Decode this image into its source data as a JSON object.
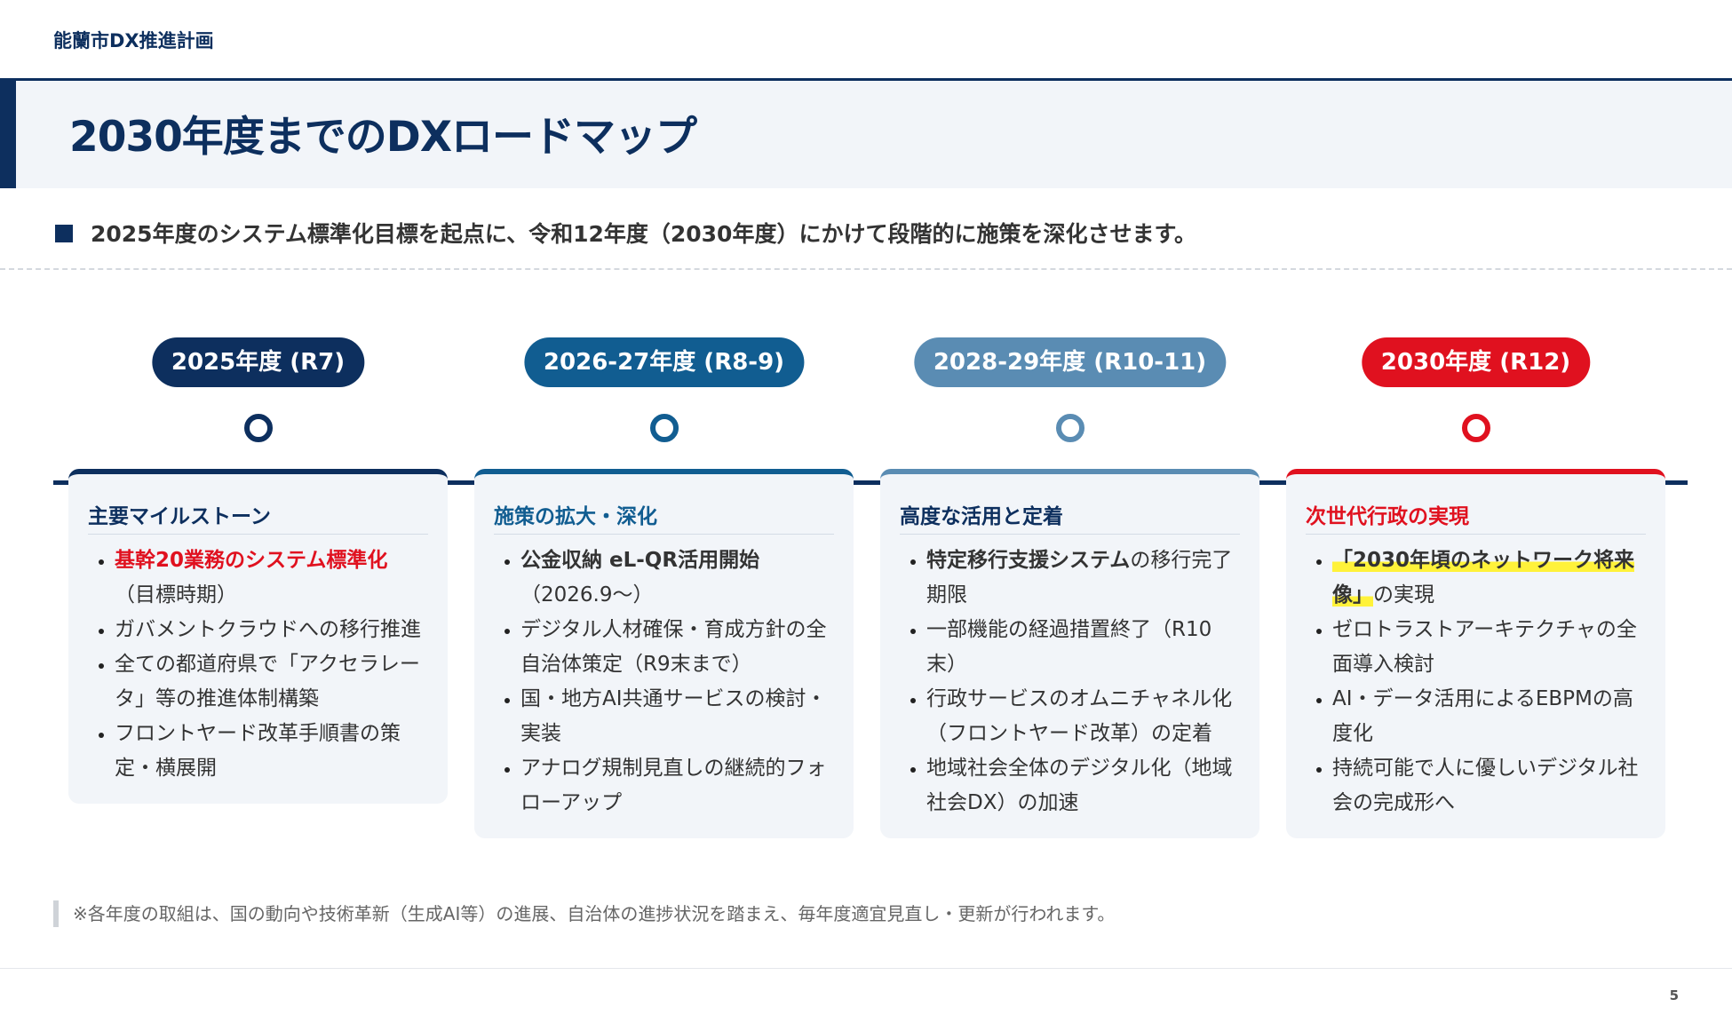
{
  "header": {
    "doc_label": "能蘭市DX推進計画",
    "title": "2030年度までのDXロードマップ"
  },
  "lead": "2025年度のシステム標準化目標を起点に、令和12年度（2030年度）にかけて段階的に施策を深化させます。",
  "colors": {
    "navy": "#0d2f5e",
    "blue": "#115d91",
    "steel": "#5a8cb3",
    "red": "#e0111f"
  },
  "phases": [
    {
      "label": "2025年度 (R7)",
      "heading": "主要マイルストーン",
      "items": [
        {
          "main": "基幹20業務のシステム標準化",
          "rest": "（目標時期）"
        },
        {
          "main": "",
          "rest": "ガバメントクラウドへの移行推進"
        },
        {
          "main": "",
          "rest": "全ての都道府県で「アクセラレータ」等の推進体制構築"
        },
        {
          "main": "",
          "rest": "フロントヤード改革手順書の策定・横展開"
        }
      ]
    },
    {
      "label": "2026-27年度 (R8-9)",
      "heading": "施策の拡大・深化",
      "items": [
        {
          "main": "公金収納 eL-QR活用開始",
          "rest": "（2026.9〜）"
        },
        {
          "main": "",
          "rest": "デジタル人材確保・育成方針の全自治体策定（R9末まで）"
        },
        {
          "main": "",
          "rest": "国・地方AI共通サービスの検討・実装"
        },
        {
          "main": "",
          "rest": "アナログ規制見直しの継続的フォローアップ"
        }
      ]
    },
    {
      "label": "2028-29年度 (R10-11)",
      "heading": "高度な活用と定着",
      "items": [
        {
          "main": "特定移行支援システム",
          "rest": "の移行完了期限"
        },
        {
          "main": "",
          "rest": "一部機能の経過措置終了（R10末）"
        },
        {
          "main": "",
          "rest": "行政サービスのオムニチャネル化（フロントヤード改革）の定着"
        },
        {
          "main": "",
          "rest": "地域社会全体のデジタル化（地域社会DX）の加速"
        }
      ]
    },
    {
      "label": "2030年度 (R12)",
      "heading": "次世代行政の実現",
      "items": [
        {
          "main": "「2030年頃のネットワーク将来像」",
          "rest": "の実現"
        },
        {
          "main": "",
          "rest": "ゼロトラストアーキテクチャの全面導入検討"
        },
        {
          "main": "",
          "rest": "AI・データ活用によるEBPMの高度化"
        },
        {
          "main": "",
          "rest": "持続可能で人に優しいデジタル社会の完成形へ"
        }
      ]
    }
  ],
  "note": "※各年度の取組は、国の動向や技術革新（生成AI等）の進展、自治体の進捗状況を踏まえ、毎年度適宜見直し・更新が行われます。",
  "page_number": "5"
}
